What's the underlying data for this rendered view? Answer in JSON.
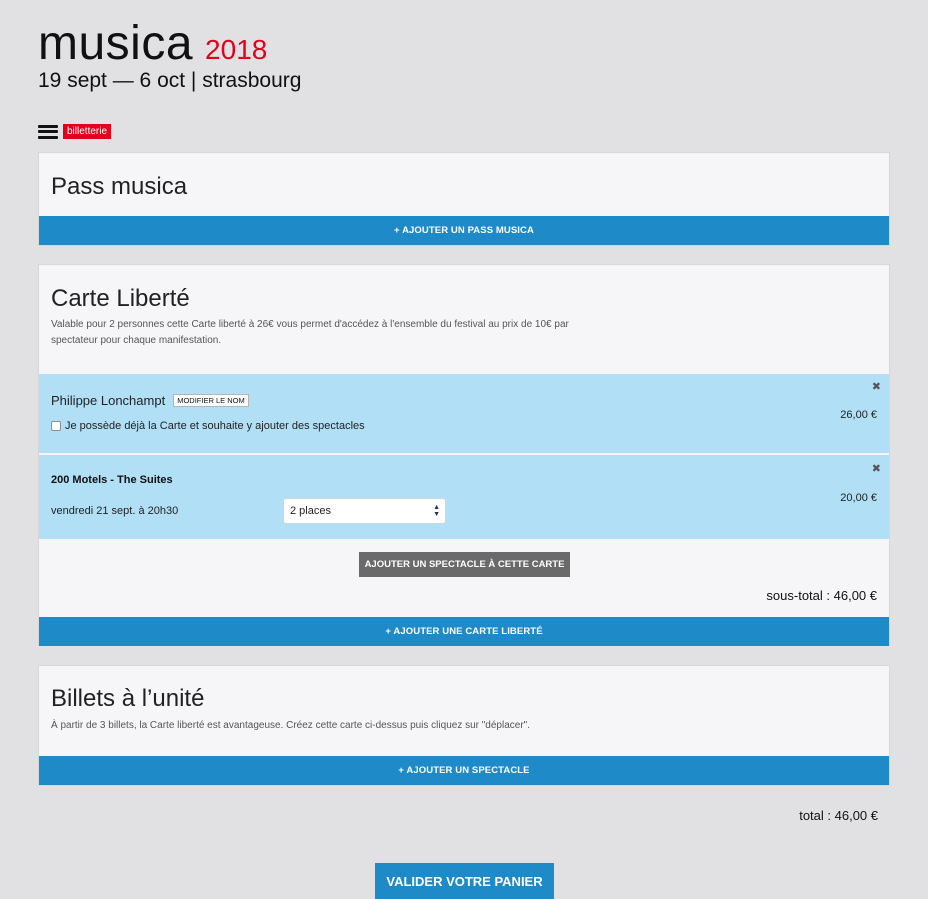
{
  "brand": {
    "name": "musica",
    "year": "2018",
    "subtitle": "19 sept — 6 oct | strasbourg"
  },
  "nav": {
    "badge": "billetterie",
    "menu_icon": "hamburger-menu-icon"
  },
  "pass": {
    "title": "Pass musica",
    "add_label": "+ AJOUTER UN PASS MUSICA"
  },
  "carte": {
    "title": "Carte Liberté",
    "description": "Valable pour 2 personnes cette Carte liberté à 26€ vous permet d'accédez à l'ensemble du festival au prix de 10€ par spectateur pour chaque manifestation.",
    "holder": {
      "name": "Philippe Lonchampt",
      "modify_label": "MODIFIER LE NOM",
      "checkbox_label": "Je possède déjà la Carte et souhaite y ajouter des spectacles",
      "price": "26,00 €",
      "remove_icon": "close-icon"
    },
    "show": {
      "title": "200 Motels - The Suites",
      "date": "vendredi 21 sept. à 20h30",
      "places_selected": "2 places",
      "price": "20,00 €"
    },
    "add_show_label": "AJOUTER UN SPECTACLE À CETTE CARTE",
    "subtotal": "sous-total : 46,00 €",
    "add_label": "+ AJOUTER UNE CARTE LIBERTÉ"
  },
  "billets": {
    "title": "Billets à l’unité",
    "description": "À partir de 3 billets, la Carte liberté est avantageuse. Créez cette carte ci-dessus puis cliquez sur \"déplacer\".",
    "add_label": "+ AJOUTER UN SPECTACLE"
  },
  "total": "total : 46,00 €",
  "validate_label": "VALIDER VOTRE PANIER",
  "colors": {
    "accent_blue": "#1f8ac8",
    "brand_red": "#e3001b",
    "row_blue": "#b1dff5",
    "background": "#e1e1e3"
  }
}
